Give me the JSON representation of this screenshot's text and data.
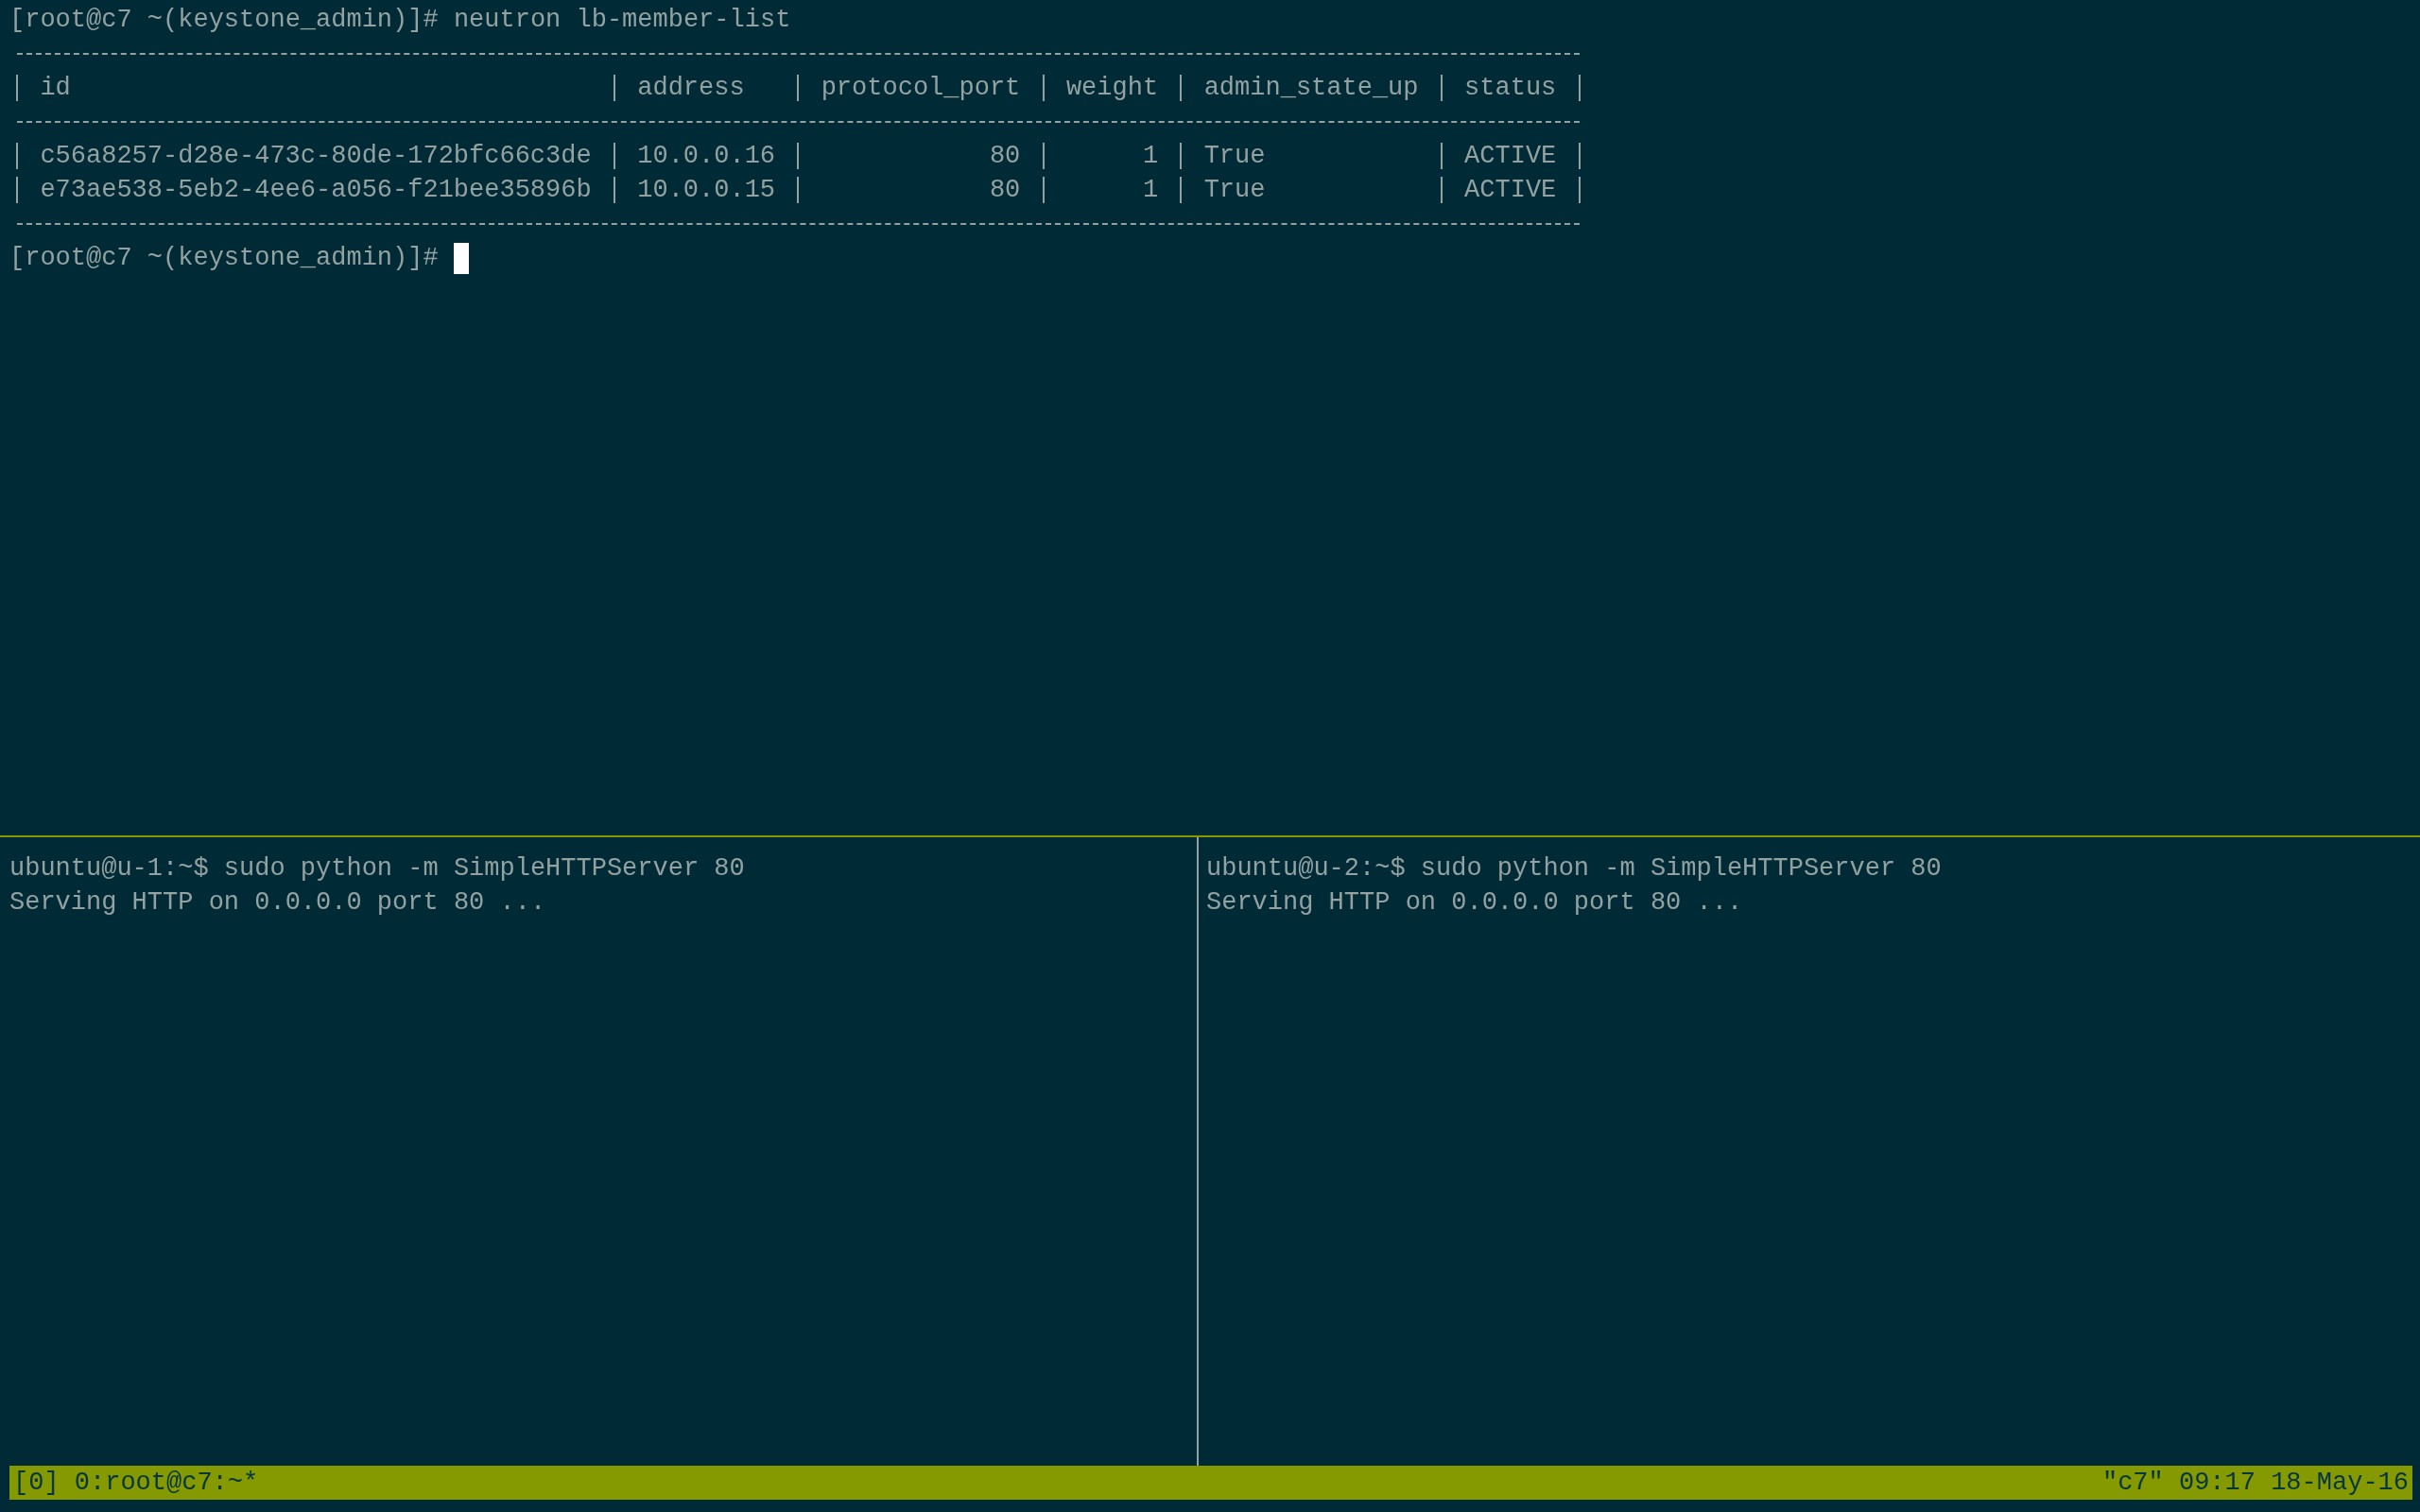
{
  "top_pane": {
    "command_line": "[root@c7 ~(keystone_admin)]# neutron lb-member-list",
    "table": {
      "columns": [
        {
          "label": "id",
          "right_aligned": false
        },
        {
          "label": "address",
          "right_aligned": false
        },
        {
          "label": "protocol_port",
          "right_aligned": true
        },
        {
          "label": "weight",
          "right_aligned": true
        },
        {
          "label": "admin_state_up",
          "right_aligned": false
        },
        {
          "label": "status"
        }
      ],
      "rows": [
        [
          "c56a8257-d28e-473c-80de-172bfc66c3de",
          "10.0.0.16",
          "80",
          "1",
          "True",
          "ACTIVE"
        ],
        [
          "e73ae538-5eb2-4ee6-a056-f21bee35896b",
          "10.0.0.15",
          "80",
          "1",
          "True",
          "ACTIVE"
        ]
      ]
    },
    "prompt": "[root@c7 ~(keystone_admin)]#",
    "cursor": true
  },
  "bottom_panes": [
    {
      "command_line": "ubuntu@u-1:~$ sudo python -m SimpleHTTPServer 80",
      "output": "Serving HTTP on 0.0.0.0 port 80 ..."
    },
    {
      "command_line": "ubuntu@u-2:~$ sudo python -m SimpleHTTPServer 80",
      "output": "Serving HTTP on 0.0.0.0 port 80 ..."
    }
  ],
  "status_bar": {
    "session": "[0]",
    "window": "0:root@c7:~*",
    "info": "\"c7\" 09:17 18-May-16"
  }
}
